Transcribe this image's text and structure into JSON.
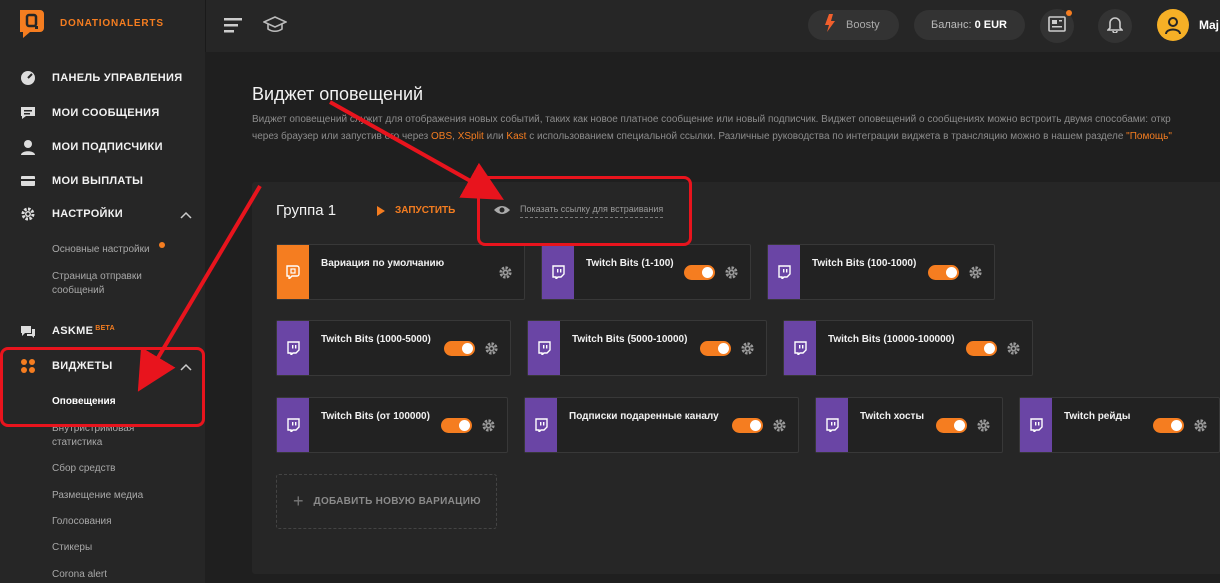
{
  "brand": "DONATIONALERTS",
  "sidebar": {
    "items": [
      {
        "label": "ПАНЕЛЬ УПРАВЛЕНИЯ",
        "icon": "dashboard-icon"
      },
      {
        "label": "МОИ СООБЩЕНИЯ",
        "icon": "messages-icon"
      },
      {
        "label": "МОИ ПОДПИСЧИКИ",
        "icon": "user-icon"
      },
      {
        "label": "МОИ ВЫПЛАТЫ",
        "icon": "wallet-icon"
      },
      {
        "label": "НАСТРОЙКИ",
        "icon": "gear-icon"
      },
      {
        "label": "ASKME",
        "badge": "BETA",
        "icon": "chat-icon"
      },
      {
        "label": "ВИДЖЕТЫ",
        "icon": "widgets-icon"
      }
    ],
    "settings_sub": [
      "Основные настройки",
      "Страница отправки сообщений"
    ],
    "widgets_sub": [
      "Оповещения",
      "Внутристримовая статистика",
      "Сбор средств",
      "Размещение медиа",
      "Голосования",
      "Стикеры",
      "Corona alert"
    ]
  },
  "header": {
    "boosty": "Boosty",
    "balance_label": "Баланс:",
    "balance_value": "0 EUR",
    "username": "Maj"
  },
  "main": {
    "title": "Виджет оповещений",
    "desc_line1": "Виджет оповещений служит для отображения новых событий, таких как новое платное сообщение или новый подписчик. Виджет оповещений о сообщениях можно встроить двумя способами: откр",
    "desc_line2_a": "через браузер или запустив его через ",
    "desc_obs": "OBS",
    "desc_sep1": ", ",
    "desc_xsplit": "XSplit",
    "desc_or": " или ",
    "desc_kast": "Kast",
    "desc_line2_b": " с использованием специальной ссылки. Различные руководства по интеграции виджета в трансляцию можно в нашем разделе ",
    "desc_help": "\"Помощь\""
  },
  "group": {
    "title": "Группа 1",
    "launch_label": "ЗАПУСТИТЬ",
    "embed_label": "Показать ссылку для встраивания",
    "add_label": "ДОБАВИТЬ НОВУЮ ВАРИАЦИЮ",
    "variations": [
      {
        "name": "Вариация по умолчанию",
        "color": "#f57d20",
        "toggle": false
      },
      {
        "name": "Twitch Bits (1-100)",
        "color": "#6a45a5",
        "toggle": true
      },
      {
        "name": "Twitch Bits (100-1000)",
        "color": "#6a45a5",
        "toggle": true
      },
      {
        "name": "Twitch Bits (1000-5000)",
        "color": "#6a45a5",
        "toggle": true
      },
      {
        "name": "Twitch Bits (5000-10000)",
        "color": "#6a45a5",
        "toggle": true
      },
      {
        "name": "Twitch Bits (10000-100000)",
        "color": "#6a45a5",
        "toggle": true
      },
      {
        "name": "Twitch Bits (от 100000)",
        "color": "#6a45a5",
        "toggle": true
      },
      {
        "name": "Подписки подаренные каналу",
        "color": "#6a45a5",
        "toggle": true
      },
      {
        "name": "Twitch хосты",
        "color": "#6a45a5",
        "toggle": true
      },
      {
        "name": "Twitch рейды",
        "color": "#6a45a5",
        "toggle": true
      }
    ]
  },
  "colors": {
    "accent": "#f57d20",
    "twitch": "#6a45a5",
    "annotation": "#e8141d"
  }
}
